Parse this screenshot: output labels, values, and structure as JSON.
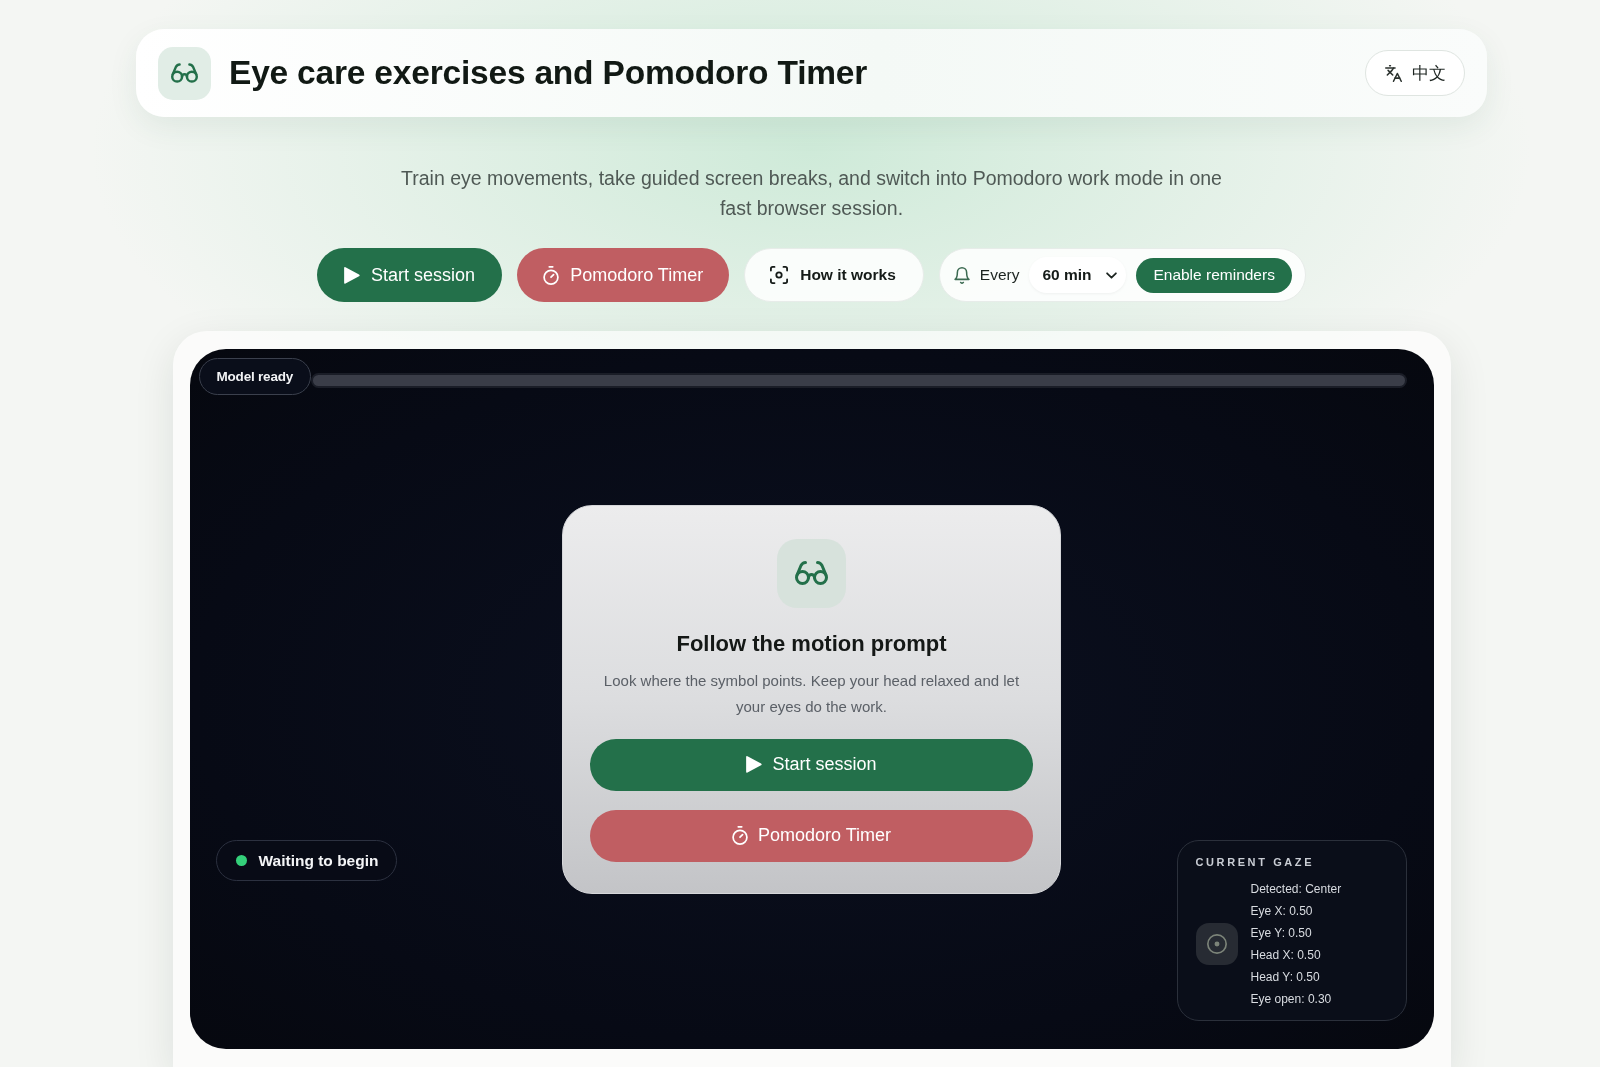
{
  "header": {
    "title": "Eye care exercises and Pomodoro Timer",
    "language_button": "中文"
  },
  "intro": "Train eye movements, take guided screen breaks, and switch into Pomodoro work mode in one fast browser session.",
  "actions": [
    {
      "kind": "start",
      "label": "Start session"
    },
    {
      "kind": "pomodoro",
      "label": "Pomodoro Timer"
    },
    {
      "kind": "help",
      "label": "How it works"
    }
  ],
  "reminders": {
    "label": "Every",
    "interval": "60 min",
    "button": "Enable reminders"
  },
  "stage": {
    "model_status": "Model ready",
    "model_progress": {
      "level": 1
    },
    "prompt_card": {
      "title": "Follow the motion prompt",
      "text": "Look where the symbol points. Keep your head relaxed and let your eyes do the work.",
      "buttons": [
        {
          "kind": "start",
          "label": "Start session"
        },
        {
          "kind": "pomodoro",
          "label": "Pomodoro Timer"
        }
      ]
    },
    "session_status": "Waiting to begin",
    "gaze_panel": {
      "title": "CURRENT GAZE",
      "readings": [
        "Detected: Center",
        "Eye X: 0.50",
        "Eye Y: 0.50",
        "Head X: 0.50",
        "Head Y: 0.50",
        "Eye open: 0.30"
      ]
    }
  }
}
